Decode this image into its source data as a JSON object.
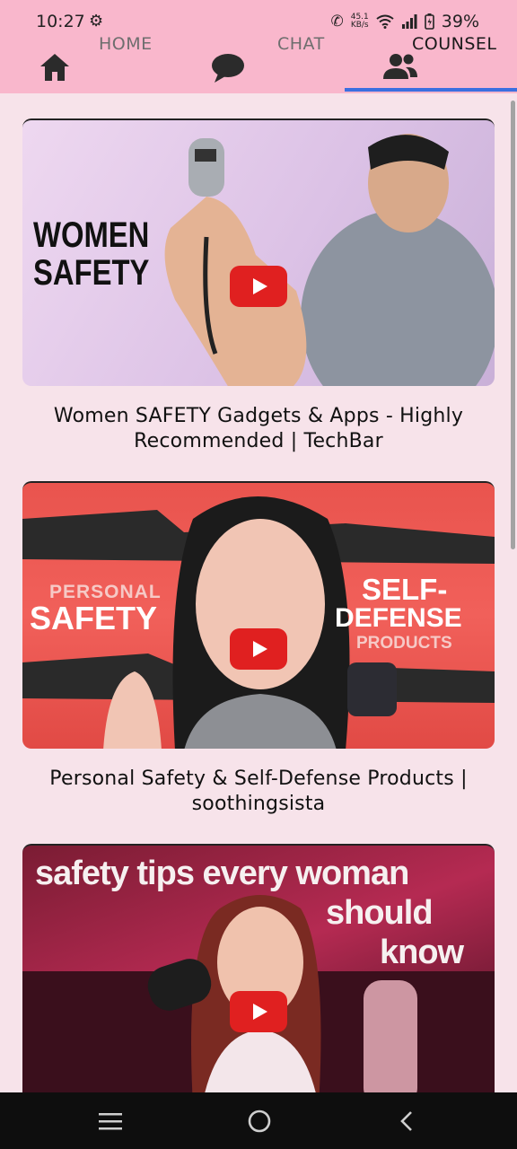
{
  "status": {
    "time": "10:27",
    "speed_value": "45.1",
    "speed_unit": "KB/s",
    "battery": "39%"
  },
  "tabs": [
    {
      "label": "HOME",
      "icon": "home-icon"
    },
    {
      "label": "CHAT",
      "icon": "chat-bubble-icon"
    },
    {
      "label": "COUNSEL",
      "icon": "people-icon",
      "active": true
    }
  ],
  "videos": [
    {
      "title": "Women SAFETY Gadgets & Apps - Highly Recommended | TechBar",
      "thumb_text": [
        "WOMEN",
        "SAFETY"
      ]
    },
    {
      "title": "Personal Safety & Self-Defense Products | soothingsista",
      "thumb_text": [
        "PERSONAL",
        "SAFETY",
        "SELF-",
        "DEFENSE",
        "PRODUCTS"
      ]
    },
    {
      "title": "",
      "thumb_text": [
        "safety tips every woman",
        "should",
        "know"
      ]
    }
  ],
  "colors": {
    "header": "#f9b7cc",
    "background": "#f7e3ea",
    "tab_indicator": "#3b6fe0",
    "play_button": "#e02020"
  },
  "nav": [
    "menu-icon",
    "home-circle-icon",
    "back-icon"
  ]
}
